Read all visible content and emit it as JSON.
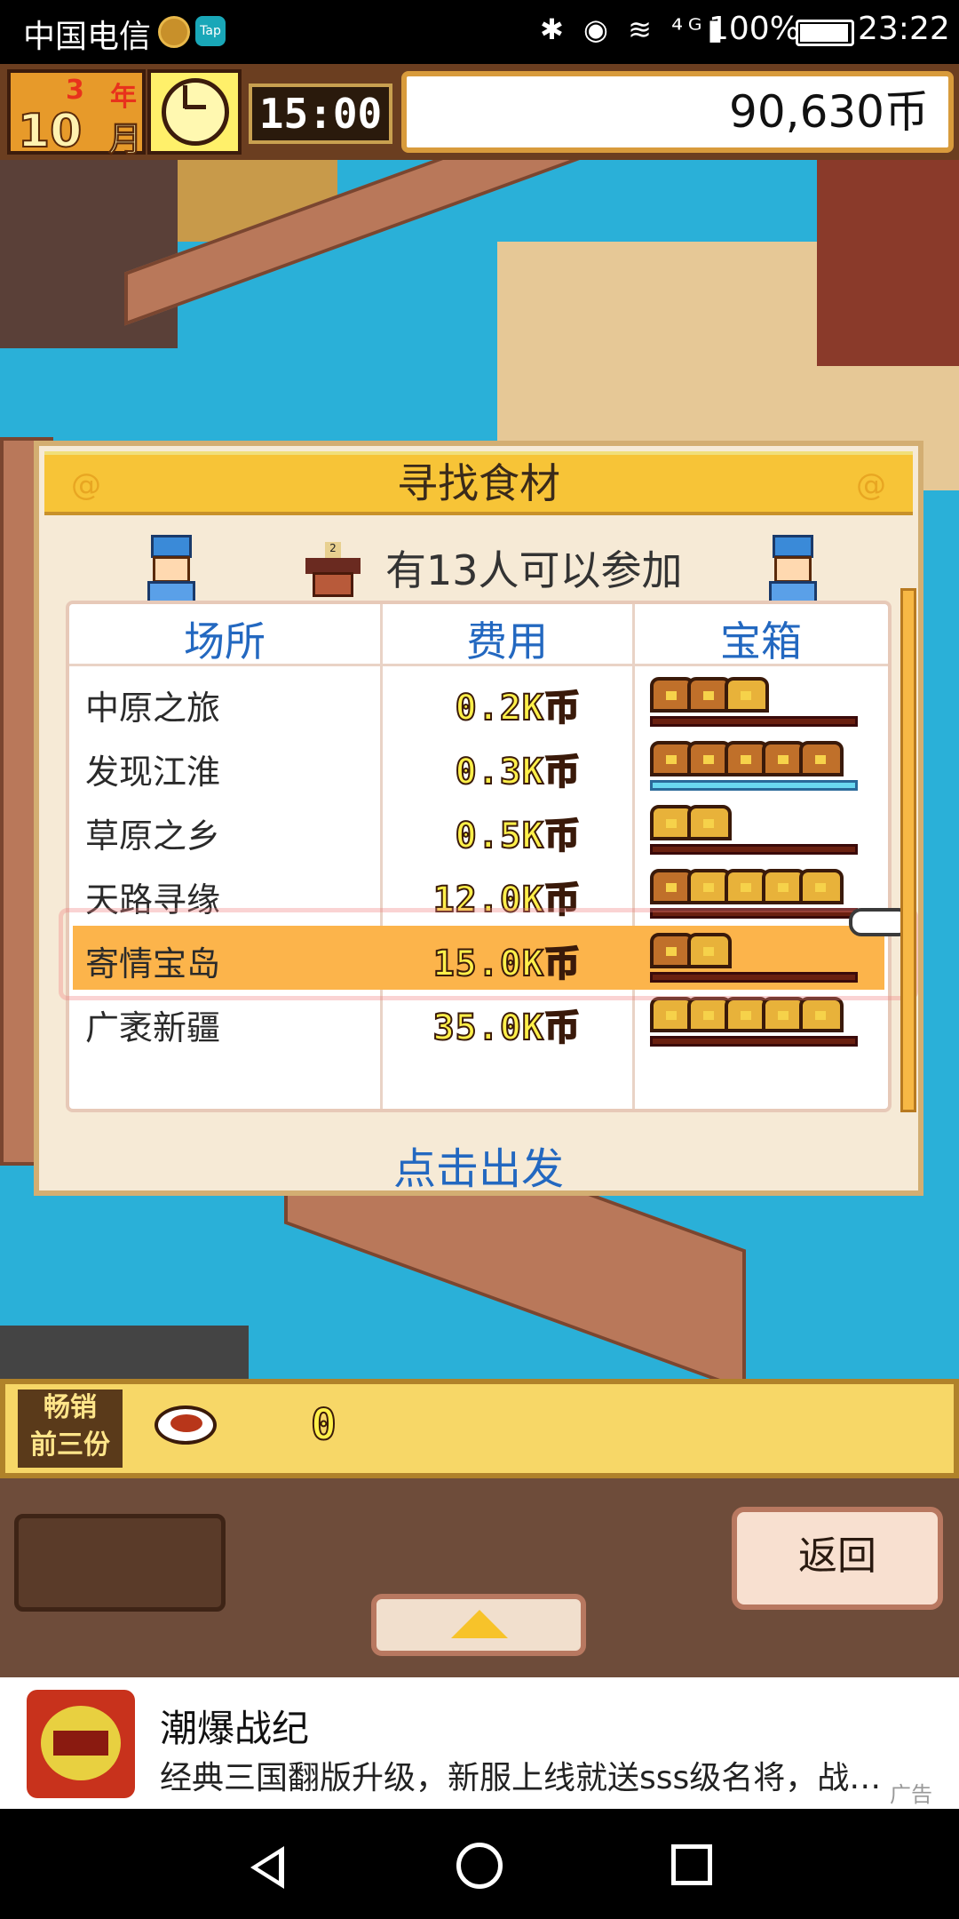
{
  "status_bar": {
    "carrier": "中国电信",
    "tap_badge": "Tap",
    "signal_icons": "✱ ◉ ≋ ⁴ᴳ▮",
    "battery": "100%",
    "time": "23:22"
  },
  "hud": {
    "year_number": "3",
    "year_label": "年",
    "month_number": "10",
    "month_label": "月",
    "time": "15:00",
    "money": "90,630币"
  },
  "dialog": {
    "title": "寻找食材",
    "participants": "有13人可以参加",
    "shrine_tag": "2",
    "columns": [
      "场所",
      "费用",
      "宝箱"
    ],
    "rows": [
      {
        "place": "中原之旅",
        "cost": "0.2K币",
        "chests": 3,
        "gold": [
          2
        ]
      },
      {
        "place": "发现江淮",
        "cost": "0.3K币",
        "chests": 5,
        "gold": [],
        "bar": "full"
      },
      {
        "place": "草原之乡",
        "cost": "0.5K币",
        "chests": 2,
        "gold": [
          0,
          1
        ]
      },
      {
        "place": "天路寻缘",
        "cost": "12.0K币",
        "chests": 5,
        "gold": [
          1,
          2,
          3,
          4
        ]
      },
      {
        "place": "寄情宝岛",
        "cost": "15.0K币",
        "chests": 2,
        "gold": [
          1
        ],
        "selected": true
      },
      {
        "place": "广袤新疆",
        "cost": "35.0K币",
        "chests": 5,
        "gold": [
          0,
          1,
          2,
          3,
          4
        ]
      }
    ],
    "go_button": "点击出发"
  },
  "bestseller": {
    "label_line1": "畅销",
    "label_line2": "前三份",
    "count": "0"
  },
  "bottom": {
    "back_button": "返回"
  },
  "ad": {
    "title": "潮爆战纪",
    "description": "经典三国翻版升级，新服上线就送sss级名将，战…",
    "label": "广告"
  },
  "colors": {
    "header_text": "#2368c0",
    "selected_row": "#fcb44b",
    "title_bar": "#f7c437"
  }
}
